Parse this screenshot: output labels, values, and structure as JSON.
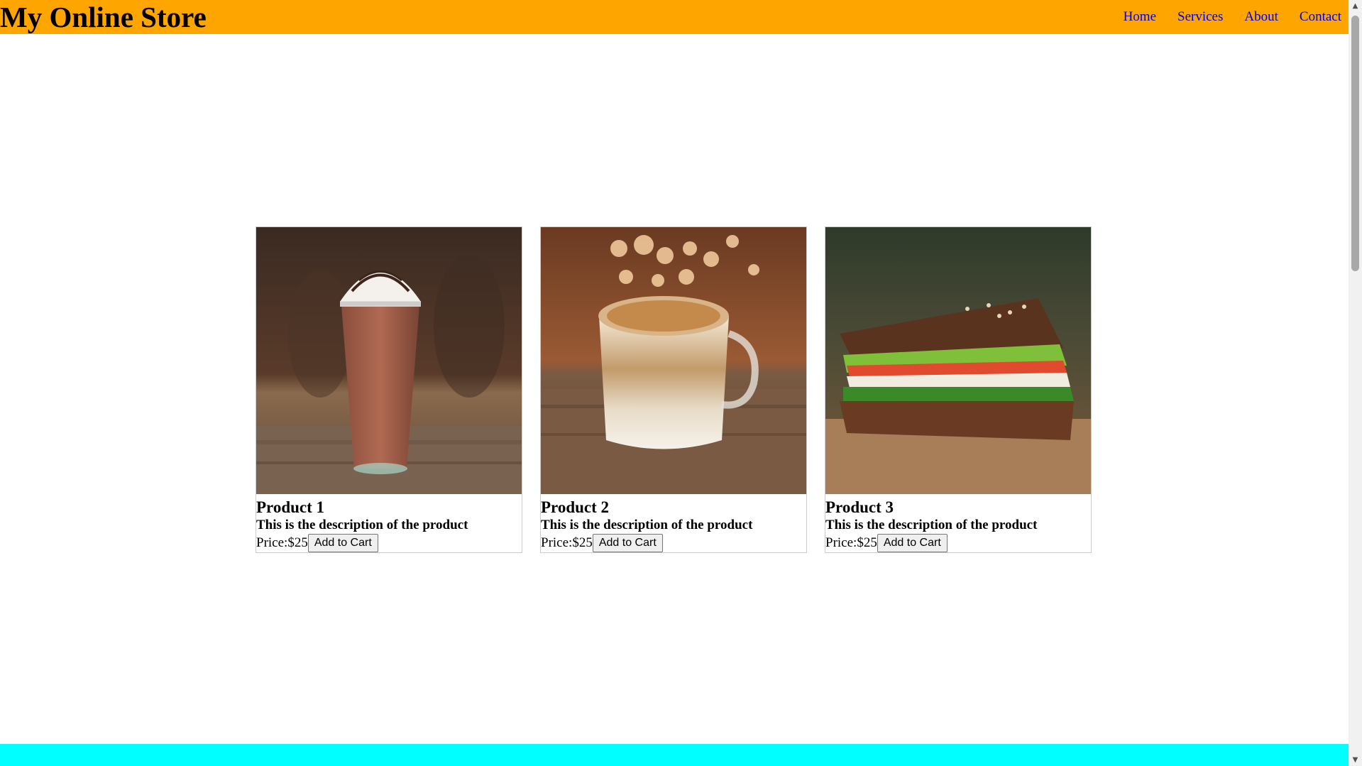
{
  "header": {
    "title": "My Online Store",
    "nav": [
      "Home",
      "Services",
      "About",
      "Contact"
    ]
  },
  "products": [
    {
      "name": "Product 1",
      "description": "This is the description of the product",
      "price_label": "Price:",
      "price": "$25",
      "button": "Add to Cart",
      "image": "chocolate-frappe-photo"
    },
    {
      "name": "Product 2",
      "description": "This is the description of the product",
      "price_label": "Price:",
      "price": "$25",
      "button": "Add to Cart",
      "image": "latte-mug-photo"
    },
    {
      "name": "Product 3",
      "description": "This is the description of the product",
      "price_label": "Price:",
      "price": "$25",
      "button": "Add to Cart",
      "image": "sandwich-photo"
    }
  ],
  "colors": {
    "header_bg": "#ffa500",
    "footer_bg": "#00ffff",
    "link": "#0000ee"
  }
}
